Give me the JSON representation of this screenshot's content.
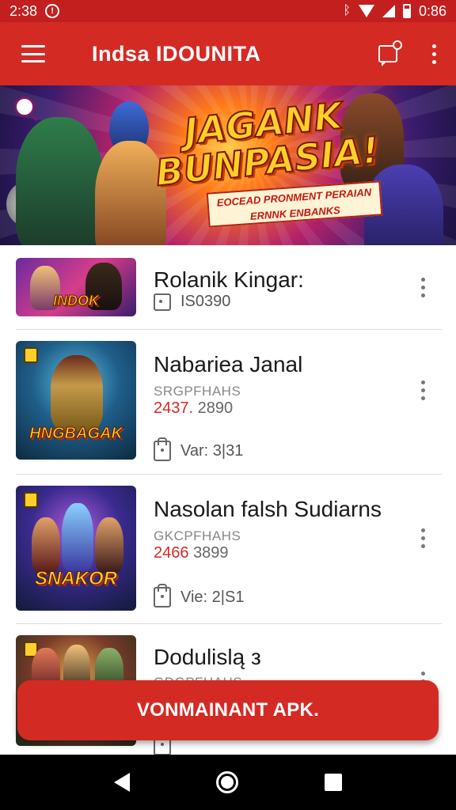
{
  "status_bar": {
    "time": "2:38",
    "clock_right": "0:86",
    "icons": [
      "notification-icon",
      "bluetooth-icon",
      "wifi-icon",
      "signal-icon",
      "battery-icon"
    ]
  },
  "app_bar": {
    "title": "Indsa IDOUNITA",
    "icons": [
      "menu-icon",
      "notification-bell-icon",
      "more-vert-icon"
    ]
  },
  "banner": {
    "headline_line1": "JAGANK",
    "headline_line2": "BUNPASIA!",
    "ribbon_line1": "EOCEAD PRONMENT PERAIAN",
    "ribbon_line2": "ERNNK ENBANKS"
  },
  "apps": [
    {
      "title": "Rolanik Kingar:",
      "subtitle": "",
      "meta_red": "",
      "meta": "",
      "info": "IS0390",
      "thumb_text": "INDOK"
    },
    {
      "title": "Nabariea Janal",
      "subtitle": "SRGPFHAHS",
      "meta_red": "2437.",
      "meta": "2890",
      "info": "Var: 3|31",
      "thumb_text": "HNGBAGAK"
    },
    {
      "title": "Nasolan falsh Sudiarns",
      "subtitle": "GKCPFHAHS",
      "meta_red": "2466",
      "meta": "3899",
      "info": "Vie: 2|S1",
      "thumb_text": "SNAKOR"
    },
    {
      "title": "Dodulislą з",
      "subtitle": "GDGPFHAHS",
      "meta_red": "",
      "meta": "",
      "info": "",
      "thumb_text": ""
    }
  ],
  "cta": {
    "label": "VONMAINANT APK."
  },
  "nav_bar": {
    "icons": [
      "back-icon",
      "home-icon",
      "recents-icon"
    ]
  },
  "colors": {
    "primary": "#d42a24",
    "status_bar": "#c41f1f",
    "nav_bar": "#000000",
    "accent_red_text": "#d42a24"
  }
}
